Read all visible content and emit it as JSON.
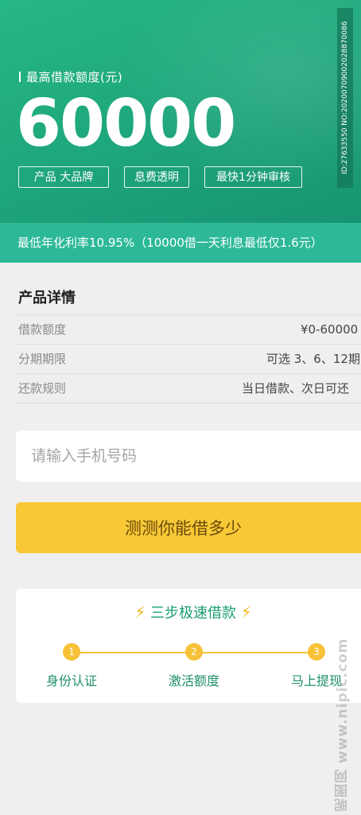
{
  "hero": {
    "subtitle": "最高借款额度(元)",
    "amount": "60000",
    "tags": [
      "产品  大品牌",
      "息费透明",
      "最快1分钟审核"
    ],
    "watermark_id": "ID:27633550 NO:20200709002028870086"
  },
  "rate_strip": {
    "text": "最低年化利率10.95%（10000借一天利息最低仅1.6元）"
  },
  "details": {
    "title": "产品详情",
    "rows": [
      {
        "label": "借款额度",
        "value": "¥0-60000"
      },
      {
        "label": "分期期限",
        "value": "可选 3、6、12期"
      },
      {
        "label": "还款规则",
        "value": "当日借款、次日可还"
      }
    ]
  },
  "phone_input": {
    "placeholder": "请输入手机号码",
    "value": ""
  },
  "cta": {
    "label": "测测你能借多少"
  },
  "steps": {
    "title": "三步极速借款",
    "bolt": "⚡",
    "items": [
      {
        "num": "1",
        "label": "身份认证"
      },
      {
        "num": "2",
        "label": "激活额度"
      },
      {
        "num": "3",
        "label": "马上提现"
      }
    ]
  },
  "site_watermark": "昵图网 www.nipic.com",
  "colors": {
    "brand_green": "#1ea57c",
    "rate_strip": "#2db998",
    "cta_yellow": "#f8c836",
    "step_yellow": "#f7c238",
    "page_bg": "#efefef"
  }
}
